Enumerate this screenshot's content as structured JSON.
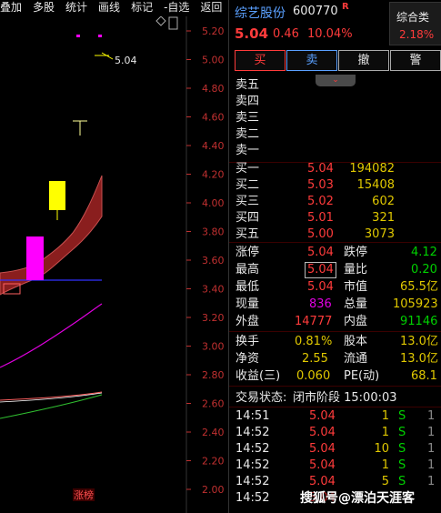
{
  "toolbar": [
    "叠加",
    "多股",
    "统计",
    "画线",
    "标记",
    "-自选",
    "返回"
  ],
  "chart": {
    "price_ticks": [
      "5.20",
      "5.00",
      "4.80",
      "4.60",
      "4.40",
      "4.20",
      "4.00",
      "3.80",
      "3.60",
      "3.40",
      "3.20",
      "3.00",
      "2.80",
      "2.60",
      "2.40",
      "2.20",
      "2.00"
    ],
    "high_annotation": "5.04",
    "bottom_tag": "涨榜",
    "colors": {
      "up": "#ff00ff",
      "down": "#ffff00",
      "axis": "#c03030"
    }
  },
  "header": {
    "name": "综艺股份",
    "code": "600770",
    "badge": "R",
    "sector_name": "综合类",
    "sector_pct": "2.18%",
    "price": "5.04",
    "change": "0.46",
    "change_pct": "10.04%"
  },
  "actions": {
    "buy": "买",
    "sell": "卖",
    "cancel": "撤",
    "alert": "警"
  },
  "asks": [
    {
      "label": "卖五",
      "price": "",
      "vol": ""
    },
    {
      "label": "卖四",
      "price": "",
      "vol": ""
    },
    {
      "label": "卖三",
      "price": "",
      "vol": ""
    },
    {
      "label": "卖二",
      "price": "",
      "vol": ""
    },
    {
      "label": "卖一",
      "price": "",
      "vol": ""
    }
  ],
  "bids": [
    {
      "label": "买一",
      "price": "5.04",
      "vol": "194082"
    },
    {
      "label": "买二",
      "price": "5.03",
      "vol": "15408"
    },
    {
      "label": "买三",
      "price": "5.02",
      "vol": "602"
    },
    {
      "label": "买四",
      "price": "5.01",
      "vol": "321"
    },
    {
      "label": "买五",
      "price": "5.00",
      "vol": "3073"
    }
  ],
  "quote": {
    "limit_up_label": "涨停",
    "limit_up": "5.04",
    "limit_down_label": "跌停",
    "limit_down": "4.12",
    "high_label": "最高",
    "high": "5.04",
    "volume_ratio_label": "量比",
    "volume_ratio": "0.20",
    "low_label": "最低",
    "low": "5.04",
    "pb_label": "市值",
    "pb": "65.5亿",
    "current_vol_label": "现量",
    "current_vol": "836",
    "total_vol_label": "总量",
    "total_vol": "105923",
    "outer_label": "外盘",
    "outer": "14777",
    "inner_label": "内盘",
    "inner": "91146",
    "turnover_label": "换手",
    "turnover": "0.81%",
    "shares_label": "股本",
    "shares": "13.0亿",
    "nav_label": "净资",
    "nav": "2.55",
    "float_label": "流通",
    "float": "13.0亿",
    "eps_label": "收益(三)",
    "eps": "0.060",
    "pe_label": "PE(动)",
    "pe": "68.1"
  },
  "status": {
    "label": "交易状态:",
    "value": "闭市阶段 15:00:03"
  },
  "ticks": [
    {
      "time": "14:51",
      "price": "5.04",
      "vol": "1",
      "side": "S",
      "num": "1"
    },
    {
      "time": "14:52",
      "price": "5.04",
      "vol": "1",
      "side": "S",
      "num": "1"
    },
    {
      "time": "14:52",
      "price": "5.04",
      "vol": "10",
      "side": "S",
      "num": "1"
    },
    {
      "time": "14:52",
      "price": "5.04",
      "vol": "1",
      "side": "S",
      "num": "1"
    },
    {
      "time": "14:52",
      "price": "5.04",
      "vol": "5",
      "side": "S",
      "num": "1"
    },
    {
      "time": "14:52",
      "price": "5.04",
      "vol": "",
      "side": "",
      "num": ""
    }
  ],
  "watermark": "搜狐号@漂泊天涯客"
}
